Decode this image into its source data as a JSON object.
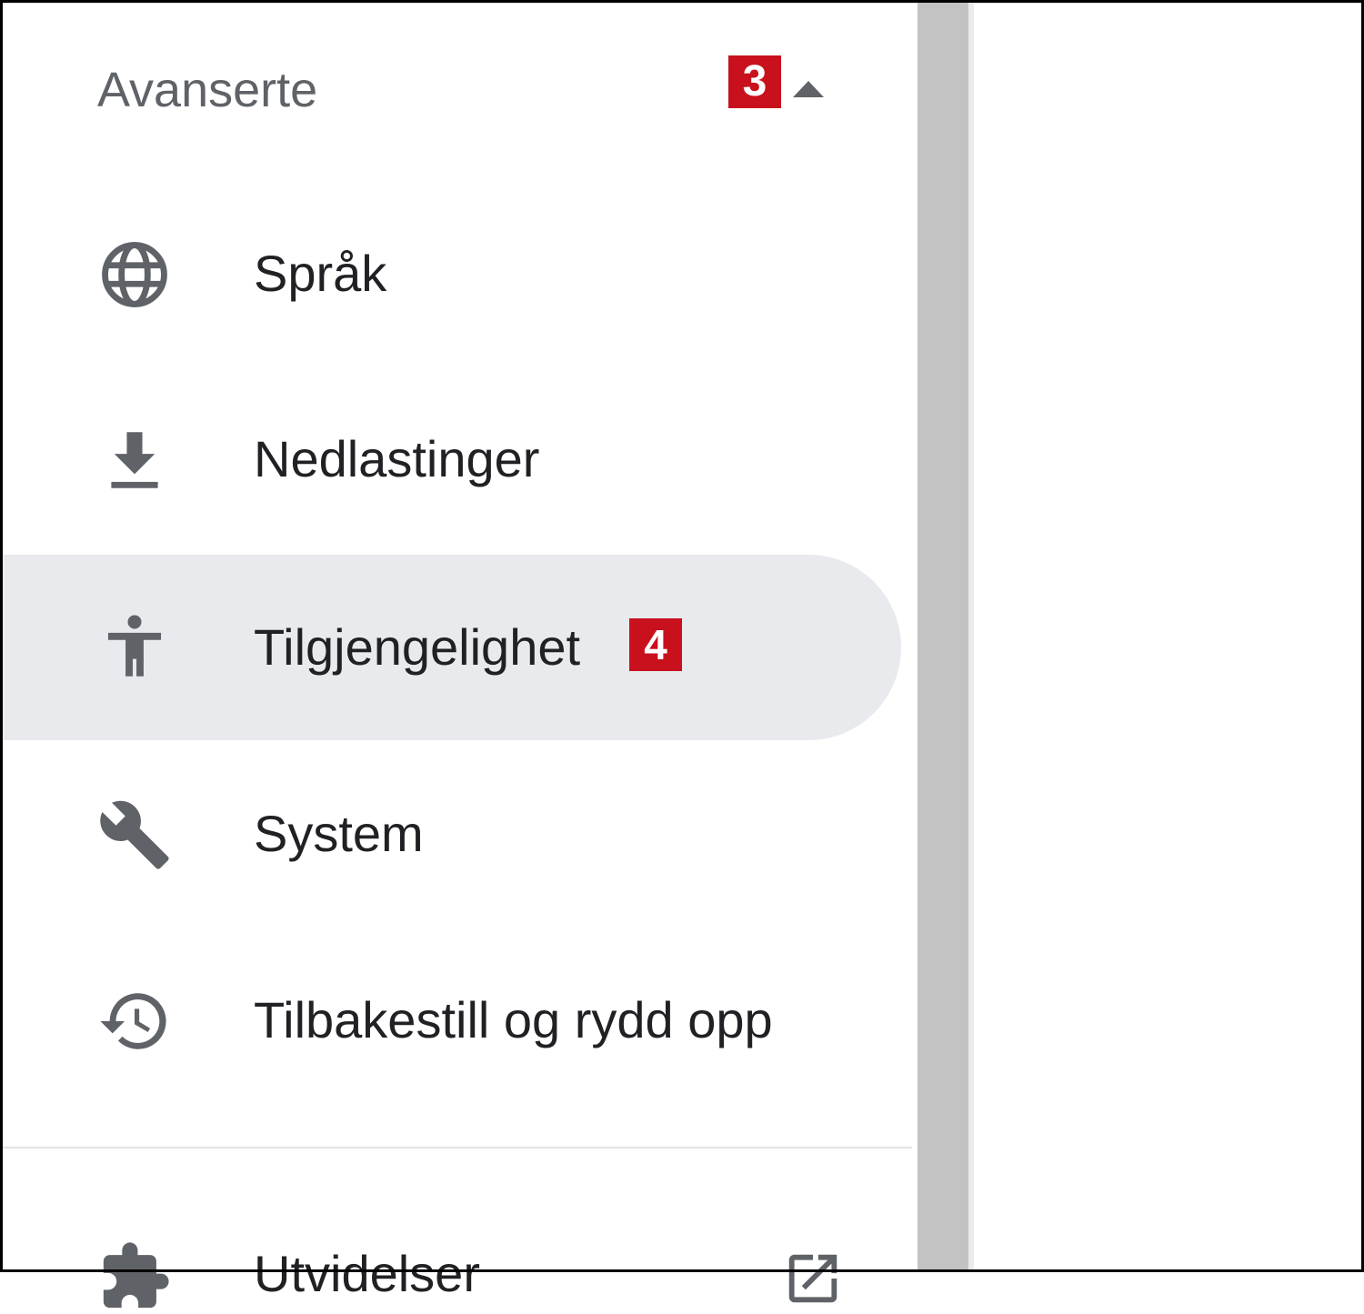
{
  "sidebar": {
    "section": {
      "title": "Avanserte",
      "badge": "3",
      "expanded": true
    },
    "items": [
      {
        "label": "Språk",
        "icon": "globe-icon",
        "active": false
      },
      {
        "label": "Nedlastinger",
        "icon": "download-icon",
        "active": false
      },
      {
        "label": "Tilgjengelighet",
        "icon": "accessibility-icon",
        "active": true,
        "badge": "4"
      },
      {
        "label": "System",
        "icon": "wrench-icon",
        "active": false
      },
      {
        "label": "Tilbakestill og rydd opp",
        "icon": "history-icon",
        "active": false
      }
    ],
    "extensions": {
      "label": "Utvidelser",
      "icon": "puzzle-icon",
      "trailing_icon": "open-in-new-icon"
    }
  },
  "colors": {
    "badge": "#c8111c",
    "active_background": "#e8eaed",
    "icon": "#5f6368",
    "text": "#202124",
    "scrollbar": "#c2c3c2"
  }
}
